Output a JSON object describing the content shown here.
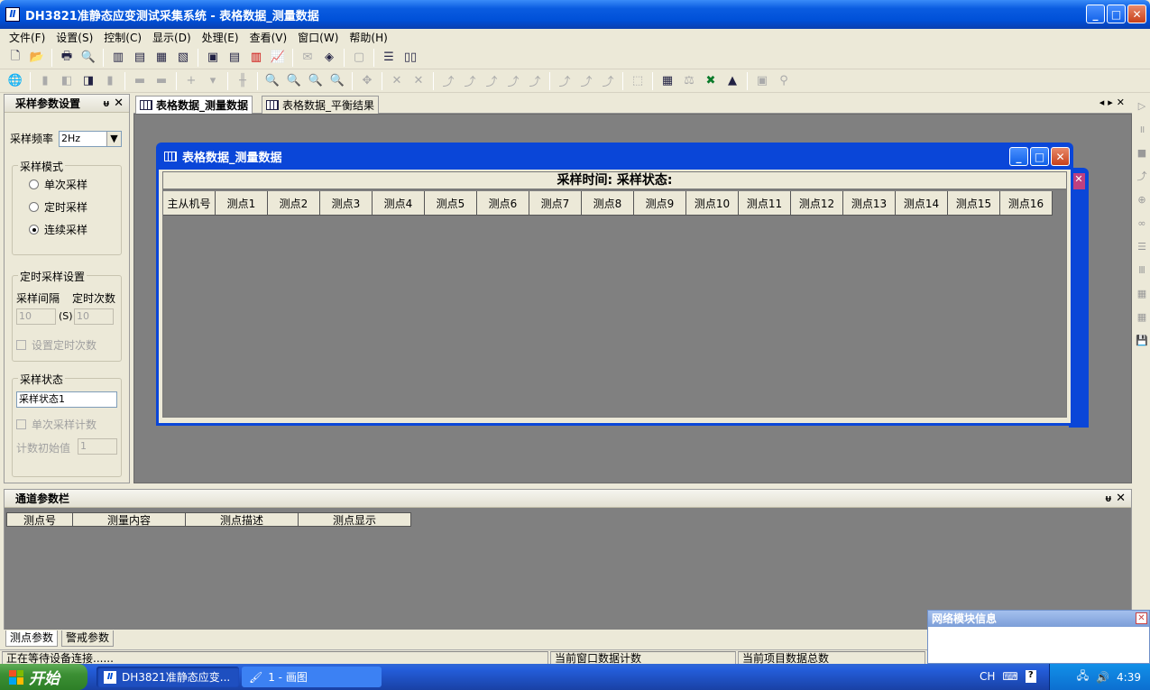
{
  "window": {
    "title": "DH3821准静态应变测试采集系统 - 表格数据_测量数据",
    "app_icon": "Ⅱ"
  },
  "menu": [
    "文件(F)",
    "设置(S)",
    "控制(C)",
    "显示(D)",
    "处理(E)",
    "查看(V)",
    "窗口(W)",
    "帮助(H)"
  ],
  "toolbar1_icons": [
    "new-icon",
    "open-icon",
    "print-icon",
    "print-preview-icon",
    "bar-view-icon",
    "wave-view-icon",
    "table-view-icon",
    "graph-view-icon",
    "grid-view-icon",
    "list-view-icon",
    "columns-view-icon",
    "trend-view-icon",
    "disabled-icon",
    "chart-icon",
    "disabled-icon",
    "layout-rows-icon",
    "layout-cols-icon"
  ],
  "left_panel": {
    "title": "采样参数设置",
    "freq_label": "采样频率",
    "freq_value": "2Hz",
    "mode_group": "采样模式",
    "modes": [
      "单次采样",
      "定时采样",
      "连续采样"
    ],
    "selected_mode": 2,
    "timer_group": "定时采样设置",
    "interval_label": "采样间隔",
    "count_label": "定时次数",
    "interval_value": "10",
    "unit": "(S)",
    "count_value": "10",
    "set_count_label": "设置定时次数",
    "status_group": "采样状态",
    "status_value": "采样状态1",
    "single_count_label": "单次采样计数",
    "count_init_label": "计数初始值",
    "count_init_value": "1"
  },
  "doc_tabs": [
    "表格数据_测量数据",
    "表格数据_平衡结果"
  ],
  "child_window": {
    "title": "表格数据_测量数据",
    "caption": "采样时间:   采样状态:",
    "columns": [
      "主从机号",
      "测点1",
      "测点2",
      "测点3",
      "测点4",
      "测点5",
      "测点6",
      "测点7",
      "测点8",
      "测点9",
      "测点10",
      "测点11",
      "测点12",
      "测点13",
      "测点14",
      "测点15",
      "测点16"
    ]
  },
  "channel_panel": {
    "title": "通道参数栏",
    "columns": [
      "测点号",
      "测量内容",
      "测点描述",
      "测点显示"
    ]
  },
  "bottom_tabs": [
    "测点参数",
    "警戒参数"
  ],
  "status": {
    "left": "正在等待设备连接......",
    "mid": "当前窗口数据计数",
    "right": "当前项目数据总数"
  },
  "net_panel": {
    "title": "网络模块信息"
  },
  "taskbar": {
    "start": "开始",
    "tasks": [
      "DH3821准静态应变...",
      "1 - 画图"
    ],
    "lang": "CH",
    "time": "4:39"
  }
}
